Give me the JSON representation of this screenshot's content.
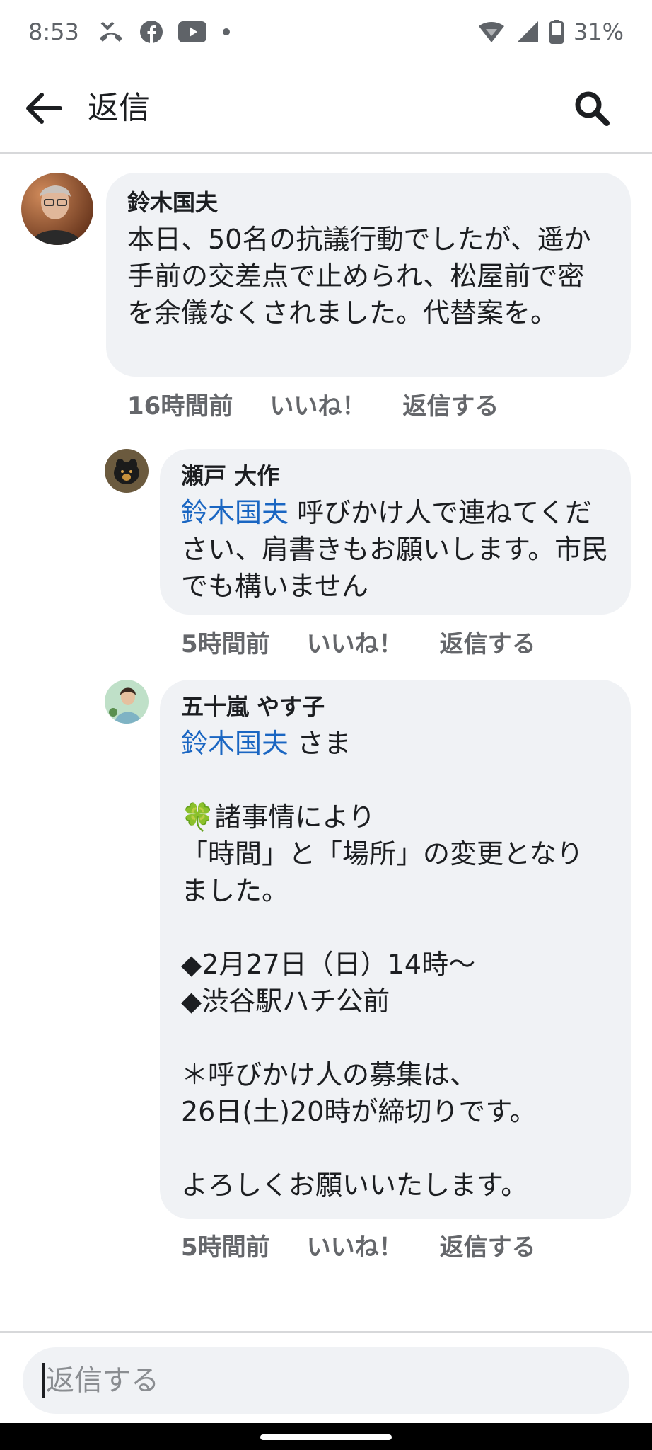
{
  "status_bar": {
    "time": "8:53",
    "battery": "31%",
    "icons": [
      "missed-call-icon",
      "facebook-icon",
      "youtube-icon",
      "dot-icon",
      "wifi-icon",
      "signal-icon",
      "battery-icon"
    ]
  },
  "header": {
    "title": "返信",
    "back_icon": "back-arrow-icon",
    "search_icon": "search-icon"
  },
  "comments": [
    {
      "author": "鈴木国夫",
      "text": "本日、50名の抗議行動でしたが、遥か手前の交差点で止められ、松屋前で密を余儀なくされました。代替案を。",
      "time": "16時間前",
      "like_label": "いいね！",
      "reply_label": "返信する"
    },
    {
      "author": "瀬戸 大作",
      "mention": "鈴木国夫",
      "text": " 呼びかけ人で連ねてください、肩書きもお願いします。市民でも構いません",
      "time": "5時間前",
      "like_label": "いいね！",
      "reply_label": "返信する"
    },
    {
      "author": "五十嵐 やす子",
      "mention": "鈴木国夫",
      "mention_suffix": " さま",
      "emoji": "🍀",
      "text": "諸事情により\n「時間」と「場所」の変更となりました。\n\n◆2月27日（日）14時～\n◆渋谷駅ハチ公前\n\n＊呼びかけ人の募集は、\n26日(土)20時が締切りです。\n\nよろしくお願いいたします。",
      "time": "5時間前",
      "like_label": "いいね！",
      "reply_label": "返信する"
    }
  ],
  "composer": {
    "placeholder": "返信する"
  },
  "colors": {
    "mention": "#1a66c2",
    "bubble": "#f0f2f5",
    "meta_text": "#65676b"
  }
}
